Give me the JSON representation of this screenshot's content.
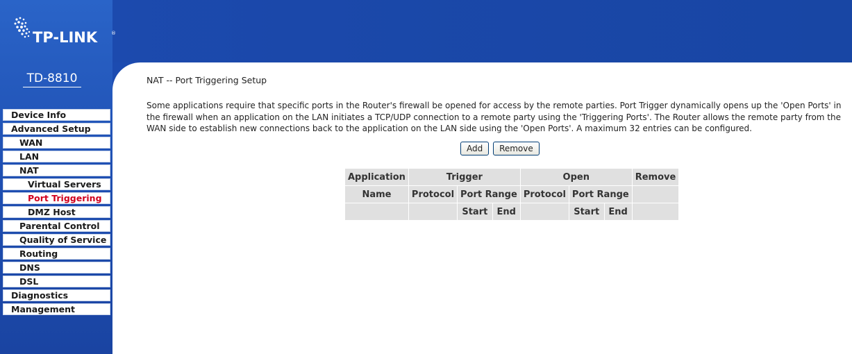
{
  "brand": {
    "logo_text": "TP-LINK",
    "trademark": "®",
    "model": "TD-8810"
  },
  "sidebar": {
    "items": [
      {
        "label": "Device Info",
        "level": 1,
        "active": false
      },
      {
        "label": "Advanced Setup",
        "level": 1,
        "active": false
      },
      {
        "label": "WAN",
        "level": 2,
        "active": false
      },
      {
        "label": "LAN",
        "level": 2,
        "active": false
      },
      {
        "label": "NAT",
        "level": 2,
        "active": false
      },
      {
        "label": "Virtual Servers",
        "level": 3,
        "active": false
      },
      {
        "label": "Port Triggering",
        "level": 3,
        "active": true
      },
      {
        "label": "DMZ Host",
        "level": 3,
        "active": false
      },
      {
        "label": "Parental Control",
        "level": 2,
        "active": false
      },
      {
        "label": "Quality of Service",
        "level": 2,
        "active": false
      },
      {
        "label": "Routing",
        "level": 2,
        "active": false
      },
      {
        "label": "DNS",
        "level": 2,
        "active": false
      },
      {
        "label": "DSL",
        "level": 2,
        "active": false
      },
      {
        "label": "Diagnostics",
        "level": 1,
        "active": false
      },
      {
        "label": "Management",
        "level": 1,
        "active": false
      }
    ]
  },
  "main": {
    "title": "NAT -- Port Triggering Setup",
    "description": "Some applications require that specific ports in the Router's firewall be opened for access by the remote parties. Port Trigger dynamically opens up the 'Open Ports' in the firewall when an application on the LAN initiates a TCP/UDP connection to a remote party using the 'Triggering Ports'. The Router allows the remote party from the WAN side to establish new connections back to the application on the LAN side using the 'Open Ports'. A maximum 32 entries can be configured.",
    "add_label": "Add",
    "remove_label": "Remove"
  },
  "table": {
    "application": "Application",
    "trigger": "Trigger",
    "open": "Open",
    "remove": "Remove",
    "name": "Name",
    "trigger_protocol": "Protocol",
    "trigger_port_range": "Port Range",
    "open_protocol": "Protocol",
    "open_port_range": "Port Range",
    "trigger_start": "Start",
    "trigger_end": "End",
    "open_start": "Start",
    "open_end": "End"
  },
  "colors": {
    "header_blue": "#1c4bb0",
    "active_menu": "#d0001e",
    "table_cell": "#e0e0e0"
  }
}
